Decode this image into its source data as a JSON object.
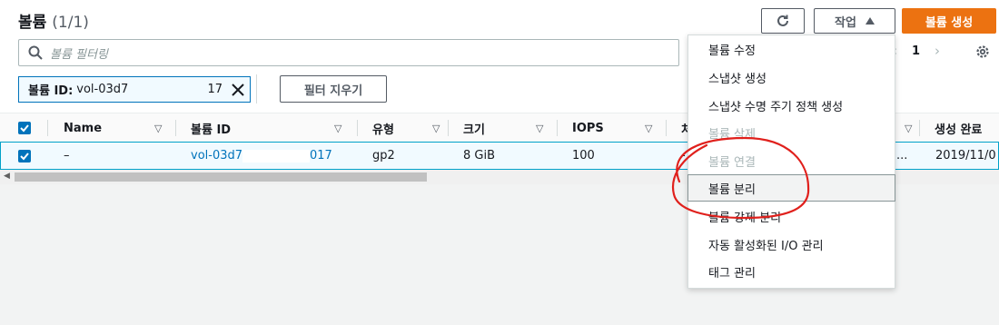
{
  "header": {
    "title": "볼륨",
    "count": "(1/1)"
  },
  "toolbar": {
    "refresh_icon": "refresh-icon",
    "actions_label": "작업",
    "actions_icon": "caret-up-icon",
    "create_label": "볼륨 생성"
  },
  "search": {
    "placeholder": "볼륨 필터링",
    "icon": "search-icon"
  },
  "pagination": {
    "page": "1",
    "prev_icon": "chevron-left-icon",
    "next_icon": "chevron-right-icon"
  },
  "filter_token": {
    "label": "볼륨 ID:",
    "value": "vol-03d7",
    "suffix": "17",
    "remove_icon": "close-icon"
  },
  "clear_filters_label": "필터 지우기",
  "table": {
    "columns": [
      "Name",
      "볼륨 ID",
      "유형",
      "크기",
      "IOPS",
      "처",
      "생성 완료"
    ],
    "row": {
      "name": "–",
      "volume_id_prefix": "vol-03d7",
      "volume_id_suffix": "017",
      "type": "gp2",
      "size": "8 GiB",
      "iops": "100",
      "throughput": "-",
      "truncated": "...",
      "created": "2019/11/0"
    }
  },
  "menu": {
    "items": [
      {
        "label": "볼륨 수정",
        "state": "enabled"
      },
      {
        "label": "스냅샷 생성",
        "state": "enabled"
      },
      {
        "label": "스냅샷 수명 주기 정책 생성",
        "state": "enabled"
      },
      {
        "label": "볼륨 삭제",
        "state": "disabled"
      },
      {
        "label": "볼륨 연결",
        "state": "disabled"
      },
      {
        "label": "볼륨 분리",
        "state": "hover"
      },
      {
        "label": "볼륨 강제 분리",
        "state": "enabled"
      },
      {
        "label": "자동 활성화된 I/O 관리",
        "state": "enabled"
      },
      {
        "label": "태그 관리",
        "state": "enabled"
      }
    ]
  },
  "colors": {
    "accent": "#ec7211",
    "link": "#0073bb",
    "selected_row": "#f1faff",
    "annotation": "#e0201c"
  }
}
